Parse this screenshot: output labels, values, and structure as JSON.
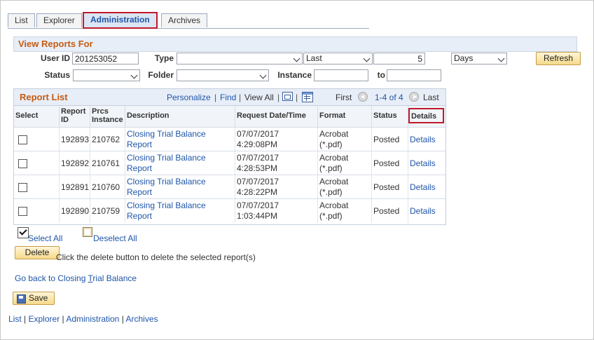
{
  "tabs": [
    {
      "label": "List",
      "active": false
    },
    {
      "label": "Explorer",
      "active": false
    },
    {
      "label": "Administration",
      "active": true
    },
    {
      "label": "Archives",
      "active": false
    }
  ],
  "view_reports": {
    "title": "View Reports For",
    "user_id_label": "User ID",
    "user_id_value": "201253052",
    "type_label": "Type",
    "type_value": "",
    "last_value": "Last",
    "last_count": "5",
    "unit_value": "Days",
    "refresh_label": "Refresh",
    "status_label": "Status",
    "status_value": "",
    "folder_label": "Folder",
    "folder_value": "",
    "instance_label": "Instance",
    "instance_from": "",
    "to_label": "to",
    "instance_to": ""
  },
  "report_list": {
    "title": "Report List",
    "personalize": "Personalize",
    "find": "Find",
    "view_all": "View All",
    "first": "First",
    "range": "1-4 of 4",
    "last": "Last",
    "columns": {
      "select": "Select",
      "report_id": "Report ID",
      "prcs_instance": "Prcs Instance",
      "description": "Description",
      "request_datetime": "Request Date/Time",
      "format": "Format",
      "status": "Status",
      "details": "Details"
    },
    "rows": [
      {
        "report_id": "192893",
        "prcs": "210762",
        "description": "Closing Trial Balance Report",
        "date": "07/07/2017",
        "time": "4:29:08PM",
        "format_a": "Acrobat",
        "format_b": "(*.pdf)",
        "status": "Posted",
        "details": "Details"
      },
      {
        "report_id": "192892",
        "prcs": "210761",
        "description": "Closing Trial Balance Report",
        "date": "07/07/2017",
        "time": "4:28:53PM",
        "format_a": "Acrobat",
        "format_b": "(*.pdf)",
        "status": "Posted",
        "details": "Details"
      },
      {
        "report_id": "192891",
        "prcs": "210760",
        "description": "Closing Trial Balance Report",
        "date": "07/07/2017",
        "time": "4:28:22PM",
        "format_a": "Acrobat",
        "format_b": "(*.pdf)",
        "status": "Posted",
        "details": "Details"
      },
      {
        "report_id": "192890",
        "prcs": "210759",
        "description": "Closing Trial Balance Report",
        "date": "07/07/2017",
        "time": "1:03:44PM",
        "format_a": "Acrobat",
        "format_b": "(*.pdf)",
        "status": "Posted",
        "details": "Details"
      }
    ]
  },
  "actions": {
    "select_all": "Select All",
    "deselect_all": "Deselect All",
    "delete_label": "Delete",
    "delete_hint": "Click the delete button to delete the selected report(s)",
    "go_back_prefix": "Go back to Closing ",
    "go_back_underlined": "T",
    "go_back_suffix": "rial Balance",
    "save_label": "Save"
  },
  "footer": {
    "links": [
      "List",
      "Explorer",
      "Administration",
      "Archives"
    ],
    "separator": "|"
  },
  "colors": {
    "accent_orange": "#c55b13",
    "link_blue": "#1f55a8",
    "highlight_red": "#c0192a",
    "button_gold": "#f6d98a"
  }
}
